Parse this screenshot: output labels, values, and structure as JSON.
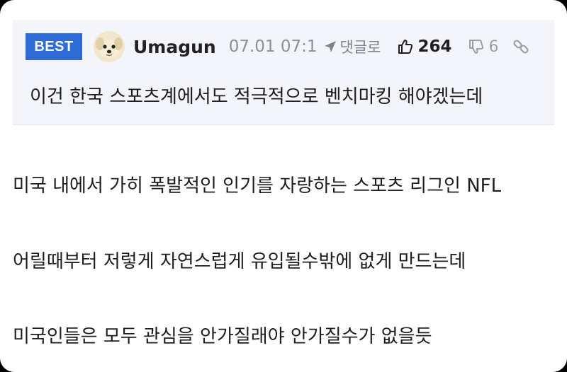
{
  "best_comment": {
    "badge": "BEST",
    "username": "Umagun",
    "timestamp": "07.01 07:1",
    "reply_label": "댓글로",
    "likes": "264",
    "dislikes": "6",
    "text": "이건 한국 스포츠계에서도 적극적으로 벤치마킹 해야겠는데"
  },
  "post_body": {
    "lines": [
      "미국 내에서 가히 폭발적인 인기를 자랑하는 스포츠 리그인 NFL",
      "어릴때부터 저렇게 자연스럽게 유입될수밖에 없게 만드는데",
      "미국인들은 모두 관심을 안가질래야 안가질수가 없을듯"
    ]
  },
  "colors": {
    "badge": "#2d6bd7",
    "comment_bg": "#f3f5fb",
    "muted": "#8a8f99"
  },
  "icons": [
    "avatar-dog-icon",
    "reply-arrow-icon",
    "thumbs-up-icon",
    "thumbs-down-icon",
    "link-icon"
  ]
}
